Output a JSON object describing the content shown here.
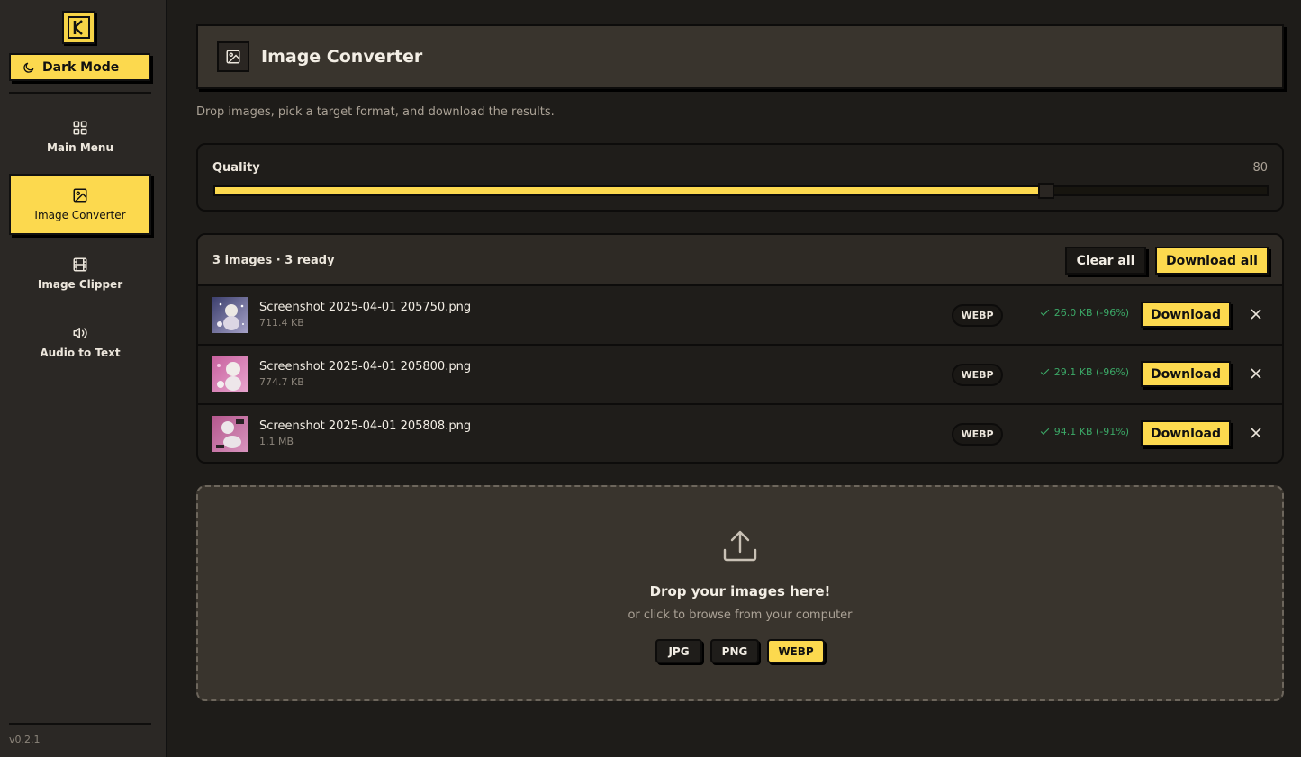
{
  "sidebar": {
    "dark_mode_label": "Dark Mode",
    "items": [
      {
        "label": "Main Menu",
        "icon": "grid-icon",
        "active": false
      },
      {
        "label": "Image Converter",
        "icon": "image-icon",
        "active": true
      },
      {
        "label": "Image Clipper",
        "icon": "film-icon",
        "active": false
      },
      {
        "label": "Audio to Text",
        "icon": "speaker-icon",
        "active": false
      }
    ],
    "version": "v0.2.1"
  },
  "header": {
    "title": "Image Converter",
    "subtitle": "Drop images, pick a target format, and download the results."
  },
  "quality": {
    "label": "Quality",
    "value": "80",
    "fraction": 0.79
  },
  "files": {
    "summary": "3 images · 3 ready",
    "clear_all_label": "Clear all",
    "download_all_label": "Download all",
    "rows": [
      {
        "name": "Screenshot 2025-04-01 205750.png",
        "size": "711.4 KB",
        "format": "WEBP",
        "result": "26.0 KB (-96%)",
        "download_label": "Download"
      },
      {
        "name": "Screenshot 2025-04-01 205800.png",
        "size": "774.7 KB",
        "format": "WEBP",
        "result": "29.1 KB (-96%)",
        "download_label": "Download"
      },
      {
        "name": "Screenshot 2025-04-01 205808.png",
        "size": "1.1 MB",
        "format": "WEBP",
        "result": "94.1 KB (-91%)",
        "download_label": "Download"
      }
    ]
  },
  "dropzone": {
    "title": "Drop your images here!",
    "subtitle": "or click to browse from your computer",
    "formats": [
      {
        "label": "JPG",
        "selected": false
      },
      {
        "label": "PNG",
        "selected": false
      },
      {
        "label": "WEBP",
        "selected": true
      }
    ]
  },
  "colors": {
    "accent": "#fcd94e",
    "background": "#1e1c19",
    "sidebar": "#2b2825",
    "success": "#3ba766"
  }
}
